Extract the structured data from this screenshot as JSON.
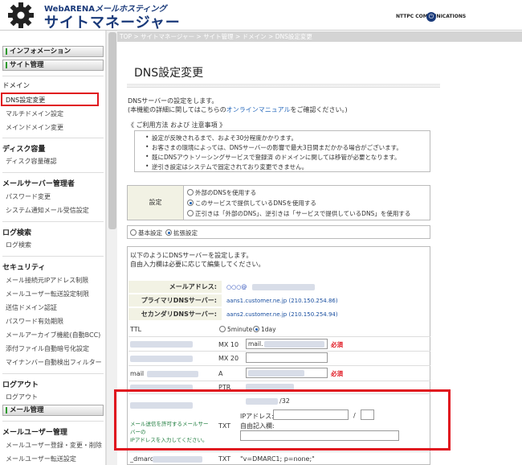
{
  "header": {
    "brand_top_prefix": "WebARENA",
    "brand_top_product": "メールホスティング",
    "brand_main": "サイトマネージャー",
    "ntt": "NTTPC COMMUNICATIONS",
    "power_icon": "⏻"
  },
  "sidebar": {
    "bar_info": "インフォメーション",
    "bar_site": "サイト管理",
    "sec_domain": "ドメイン",
    "dns": "DNS設定変更",
    "multi": "マルチドメイン設定",
    "main_domain": "メインドメイン変更",
    "sec_disk": "ディスク容量",
    "disk": "ディスク容量確認",
    "sec_mailadmin": "メールサーバー管理者",
    "pw_change": "パスワード変更",
    "notify": "システム通知メール受信設定",
    "sec_log": "ログ検索",
    "log": "ログ検索",
    "sec_security": "セキュリティ",
    "sec1": "メール接続元IPアドレス制限",
    "sec2": "メールユーザー転送設定制限",
    "sec3": "送信ドメイン認証",
    "sec4": "パスワード有効期限",
    "sec5": "メールアーカイブ機能(自動BCC)",
    "sec6": "添付ファイル自動暗号化設定",
    "sec7": "マイナンバー自動検出フィルター",
    "sec_logout": "ログアウト",
    "logout": "ログアウト",
    "bar_mail": "メール管理",
    "sec_mailuser": "メールユーザー管理",
    "mu1": "メールユーザー登録・変更・削除",
    "mu2": "メールユーザー転送設定"
  },
  "breadcrumb": "TOP > サイトマネージャー > サイト管理 > ドメイン > DNS設定変更",
  "main": {
    "title": "DNS設定変更",
    "intro1": "DNSサーバーの設定をします。",
    "intro2_a": "(本機能の詳細に関してはこちらの",
    "intro2_link": "オンラインマニュアル",
    "intro2_b": "をご確認ください。)",
    "notes_head": "《 ご利用方法 および 注意事項 》",
    "notes": [
      "設定が反映されるまで、およそ30分程度かかります。",
      "お客さまの環境によっては、DNSサーバーの影響で最大3日間まだかかる場合がございます。",
      "既にDNSアウトソーシングサービスで登録済 のドメインに関しては移管が必要となります。",
      "逆引き設定はシステムで固定されており変更できません。"
    ],
    "setting_label": "設定",
    "opt1": "外部のDNSを使用する",
    "opt2": "このサービスで提供しているDNSを使用する",
    "opt3": "正引きは「外部のDNS」、逆引きは「サービスで提供しているDNS」を使用する",
    "mode_basic": "基本設定",
    "mode_ext": "拡張設定",
    "form_intro1": "以下のようにDNSサーバーを設定します。",
    "form_intro2": "自由入力欄は必要に応じて編集してください。",
    "lbl_mail": "メールアドレス:",
    "val_mail": "○○○@",
    "lbl_primary": "プライマリDNSサーバー:",
    "val_primary": "aans1.customer.ne.jp  (210.150.254.86)",
    "lbl_secondary": "セカンダリDNSサーバー:",
    "val_secondary": "aans2.customer.ne.jp  (210.150.254.94)",
    "ttl": "TTL",
    "ttl_5": "5minute",
    "ttl_1": "1day",
    "mx10": "MX 10",
    "mx20": "MX 20",
    "mx_input": "mail.",
    "required": "必須",
    "mail_host": "mail",
    "a": "A",
    "ptr": "PTR",
    "txt": "TXT",
    "ip_label": "IPアドレス:",
    "slash": "/",
    "free_label": "自由記入欄:",
    "suffix32": "/32",
    "green1": "メール送信を許可するメールサー",
    "green2": "バーの",
    "green3": "IPアドレスを入力してください。",
    "dmarc_label": "_dmarc",
    "dmarc_val": "\"v=DMARC1; p=none;\""
  }
}
